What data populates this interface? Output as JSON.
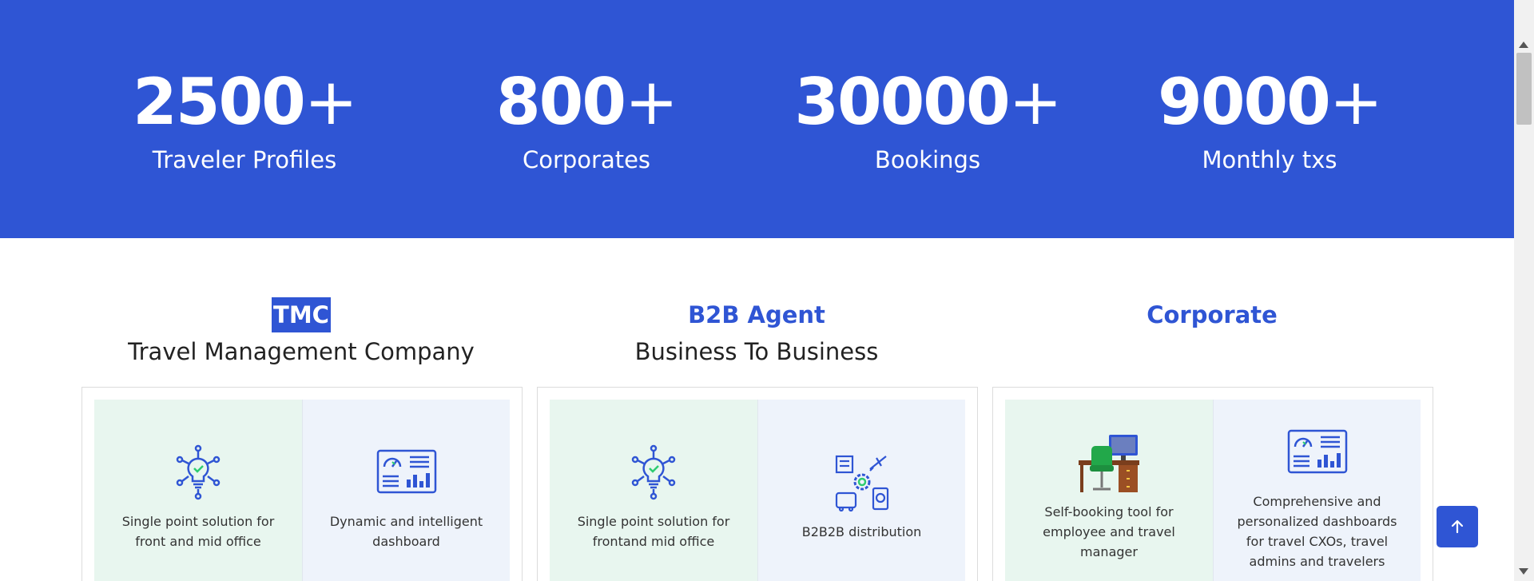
{
  "stats": [
    {
      "number": "2500",
      "suffix": "+",
      "label": "Traveler Profiles"
    },
    {
      "number": "800",
      "suffix": "+",
      "label": "Corporates"
    },
    {
      "number": "30000",
      "suffix": "+",
      "label": "Bookings"
    },
    {
      "number": "9000",
      "suffix": "+",
      "label": "Monthly txs"
    }
  ],
  "columns": [
    {
      "title": "TMC",
      "subtitle": "Travel Management Company",
      "features": [
        {
          "icon": "lightbulb-icon",
          "text": "Single point solution for front and mid office"
        },
        {
          "icon": "dashboard-icon",
          "text": "Dynamic and intelligent dashboard"
        }
      ]
    },
    {
      "title": "B2B Agent",
      "subtitle": "Business To Business",
      "features": [
        {
          "icon": "lightbulb-icon",
          "text": "Single point solution for frontand mid office"
        },
        {
          "icon": "travel-distribution-icon",
          "text": "B2B2B distribution"
        }
      ]
    },
    {
      "title": "Corporate",
      "subtitle": "",
      "features": [
        {
          "icon": "desk-computer-icon",
          "text": "Self-booking tool for employee and travel manager"
        },
        {
          "icon": "dashboard-icon",
          "text": "Comprehensive and personalized dashboards for travel CXOs, travel admins and travelers"
        }
      ]
    }
  ],
  "back_to_top": {
    "icon": "arrow-up-icon"
  },
  "colors": {
    "brand": "#2f55d4",
    "green_tile": "#e8f6ef",
    "blue_tile": "#eef3fb"
  }
}
